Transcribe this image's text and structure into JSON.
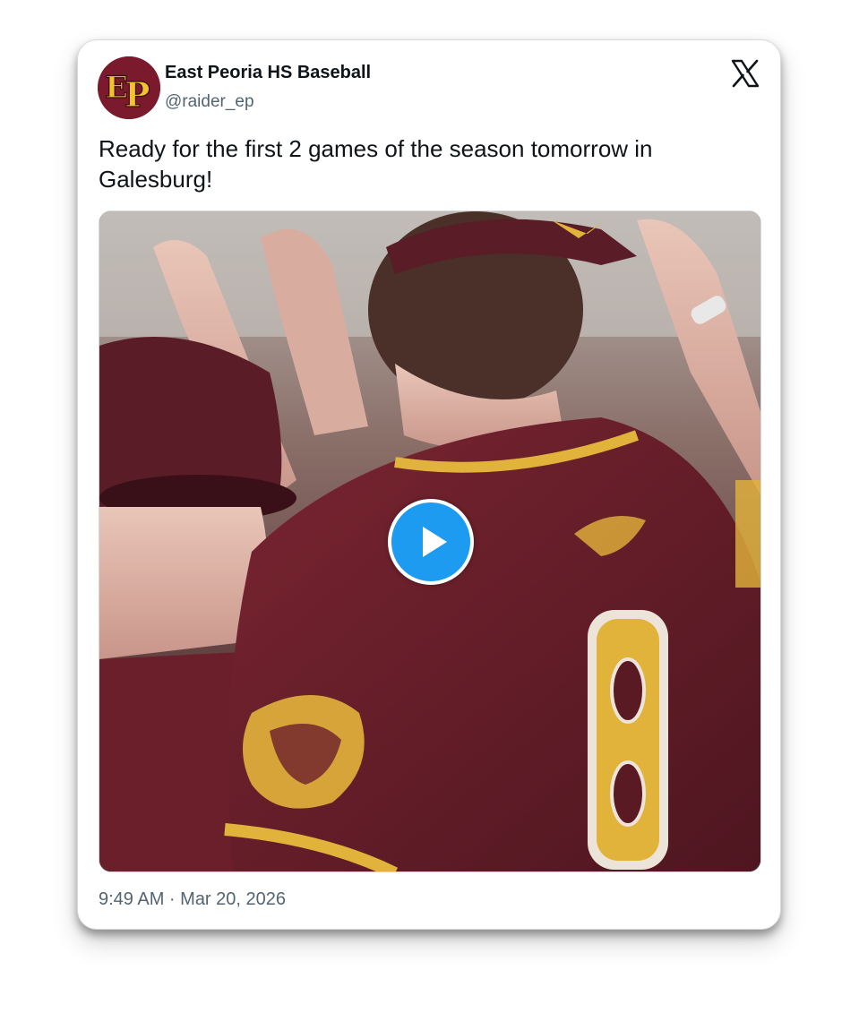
{
  "tweet": {
    "display_name": "East Peoria HS Baseball",
    "handle": "@raider_ep",
    "avatar_text": "EP",
    "text": "Ready for the first 2 games of the season tomorrow in Galesburg!",
    "timestamp": "9:49 AM · Mar 20, 2026",
    "platform_icon": "x-logo-icon",
    "media": {
      "type": "video",
      "play_icon": "play-icon",
      "jersey_number": "8"
    }
  },
  "colors": {
    "maroon": "#6e1f2b",
    "gold": "#e2b33a",
    "play_blue": "#1d9bf0",
    "text_primary": "#0f1419",
    "text_secondary": "#536471"
  }
}
